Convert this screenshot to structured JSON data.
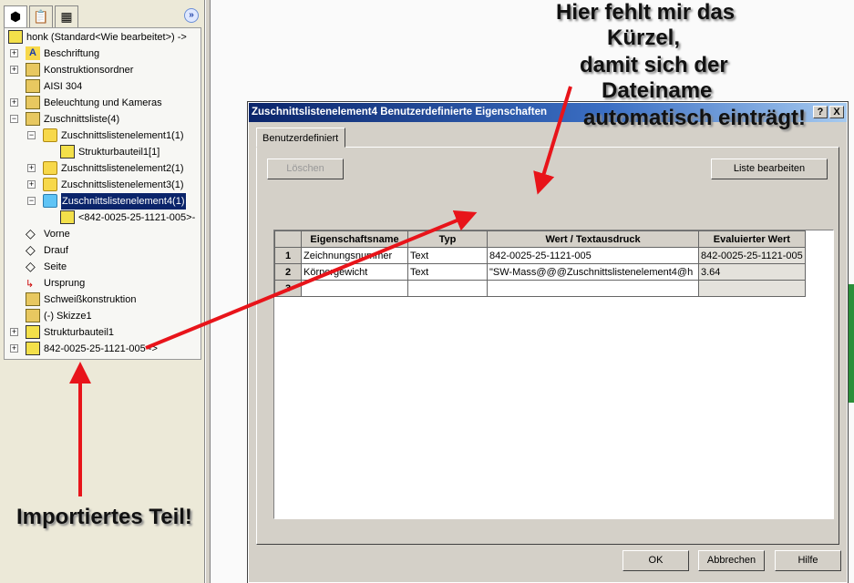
{
  "feature_tree": {
    "tabs": [
      "feature-manager",
      "property-manager",
      "configuration-manager"
    ],
    "root": "honk  (Standard<Wie bearbeitet>) ->",
    "items": [
      {
        "label": "Beschriftung",
        "icon": "annotation-icon"
      },
      {
        "label": "Konstruktionsordner",
        "icon": "design-folder-icon"
      },
      {
        "label": "AISI 304",
        "icon": "material-icon"
      },
      {
        "label": "Beleuchtung und Kameras",
        "icon": "lights-folder-icon"
      },
      {
        "label": "Zuschnittsliste(4)",
        "icon": "cut-list-icon"
      },
      {
        "label": "Zuschnittslistenelement1(1)",
        "icon": "folder-icon"
      },
      {
        "label": "Strukturbauteil1[1]",
        "icon": "body-icon"
      },
      {
        "label": "Zuschnittslistenelement2(1)",
        "icon": "folder-icon"
      },
      {
        "label": "Zuschnittslistenelement3(1)",
        "icon": "folder-icon"
      },
      {
        "label": "Zuschnittslistenelement4(1)",
        "icon": "folder-icon",
        "selected": true
      },
      {
        "label": "<842-0025-25-1121-005>-",
        "icon": "body-icon"
      },
      {
        "label": "Vorne",
        "icon": "plane-icon"
      },
      {
        "label": "Drauf",
        "icon": "plane-icon"
      },
      {
        "label": "Seite",
        "icon": "plane-icon"
      },
      {
        "label": "Ursprung",
        "icon": "origin-icon"
      },
      {
        "label": "Schweißkonstruktion",
        "icon": "weldment-icon"
      },
      {
        "label": "(-) Skizze1",
        "icon": "sketch-icon"
      },
      {
        "label": "Strukturbauteil1",
        "icon": "structural-member-icon"
      },
      {
        "label": "842-0025-25-1121-005 ->",
        "icon": "part-icon"
      }
    ]
  },
  "dialog": {
    "title": "Zuschnittslistenelement4 Benutzerdefinierte Eigenschaften",
    "help": "?",
    "close": "X",
    "tab": "Benutzerdefiniert",
    "delete_label": "Löschen",
    "edit_list_label": "Liste bearbeiten",
    "columns": [
      "",
      "Eigenschaftsname",
      "Typ",
      "Wert / Textausdruck",
      "Evaluierter Wert"
    ],
    "rows": [
      {
        "n": "1",
        "name": "Zeichnungsnummer",
        "type": "Text",
        "value": "842-0025-25-1121-005",
        "evaluated": "842-0025-25-1121-005"
      },
      {
        "n": "2",
        "name": "Körpergewicht",
        "type": "Text",
        "value": "\"SW-Mass@@@Zuschnittslistenelement4@h",
        "evaluated": "3.64"
      },
      {
        "n": "3",
        "name": "",
        "type": "",
        "value": "",
        "evaluated": ""
      }
    ],
    "ok": "OK",
    "cancel": "Abbrechen",
    "help_label": "Hilfe"
  },
  "annotations": {
    "top": [
      "Hier fehlt mir das",
      "Kürzel,",
      "damit sich der",
      "Dateiname",
      "automatisch einträgt!"
    ],
    "bottom": "Importiertes Teil!",
    "arrow_color": "#e8141a"
  }
}
